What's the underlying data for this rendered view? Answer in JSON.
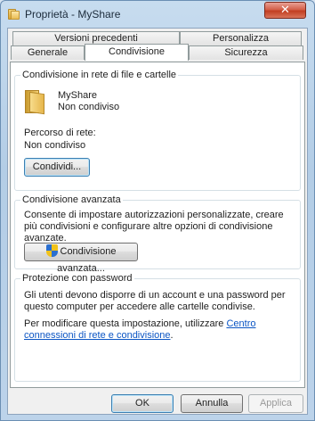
{
  "window": {
    "title": "Proprietà - MyShare",
    "close_glyph": "✕"
  },
  "tabs": {
    "row_back": [
      "Versioni precedenti",
      "Personalizza"
    ],
    "row_front": [
      "Generale",
      "Condivisione",
      "Sicurezza"
    ],
    "active": "Condivisione"
  },
  "network_sharing": {
    "legend": "Condivisione in rete di file e cartelle",
    "folder_name": "MyShare",
    "share_status": "Non condiviso",
    "path_label": "Percorso di rete:",
    "path_value": "Non condiviso",
    "share_button": "Condividi..."
  },
  "advanced_sharing": {
    "legend": "Condivisione avanzata",
    "description": "Consente di impostare autorizzazioni personalizzate, creare più condivisioni e configurare altre opzioni di condivisione avanzate.",
    "button": "Condivisione avanzata...",
    "button_icon": "uac-shield-icon"
  },
  "password_protection": {
    "legend": "Protezione con password",
    "description": "Gli utenti devono disporre di un account e una password per questo computer per accedere alle cartelle condivise.",
    "change_text": "Per modificare questa impostazione, utilizzare ",
    "link_text": "Centro connessioni di rete e condivisione",
    "period": "."
  },
  "footer": {
    "ok": "OK",
    "cancel": "Annulla",
    "apply": "Applica"
  },
  "colors": {
    "link": "#0b55c4",
    "close_button": "#c23e21",
    "title_bar": "#b3cde6"
  }
}
